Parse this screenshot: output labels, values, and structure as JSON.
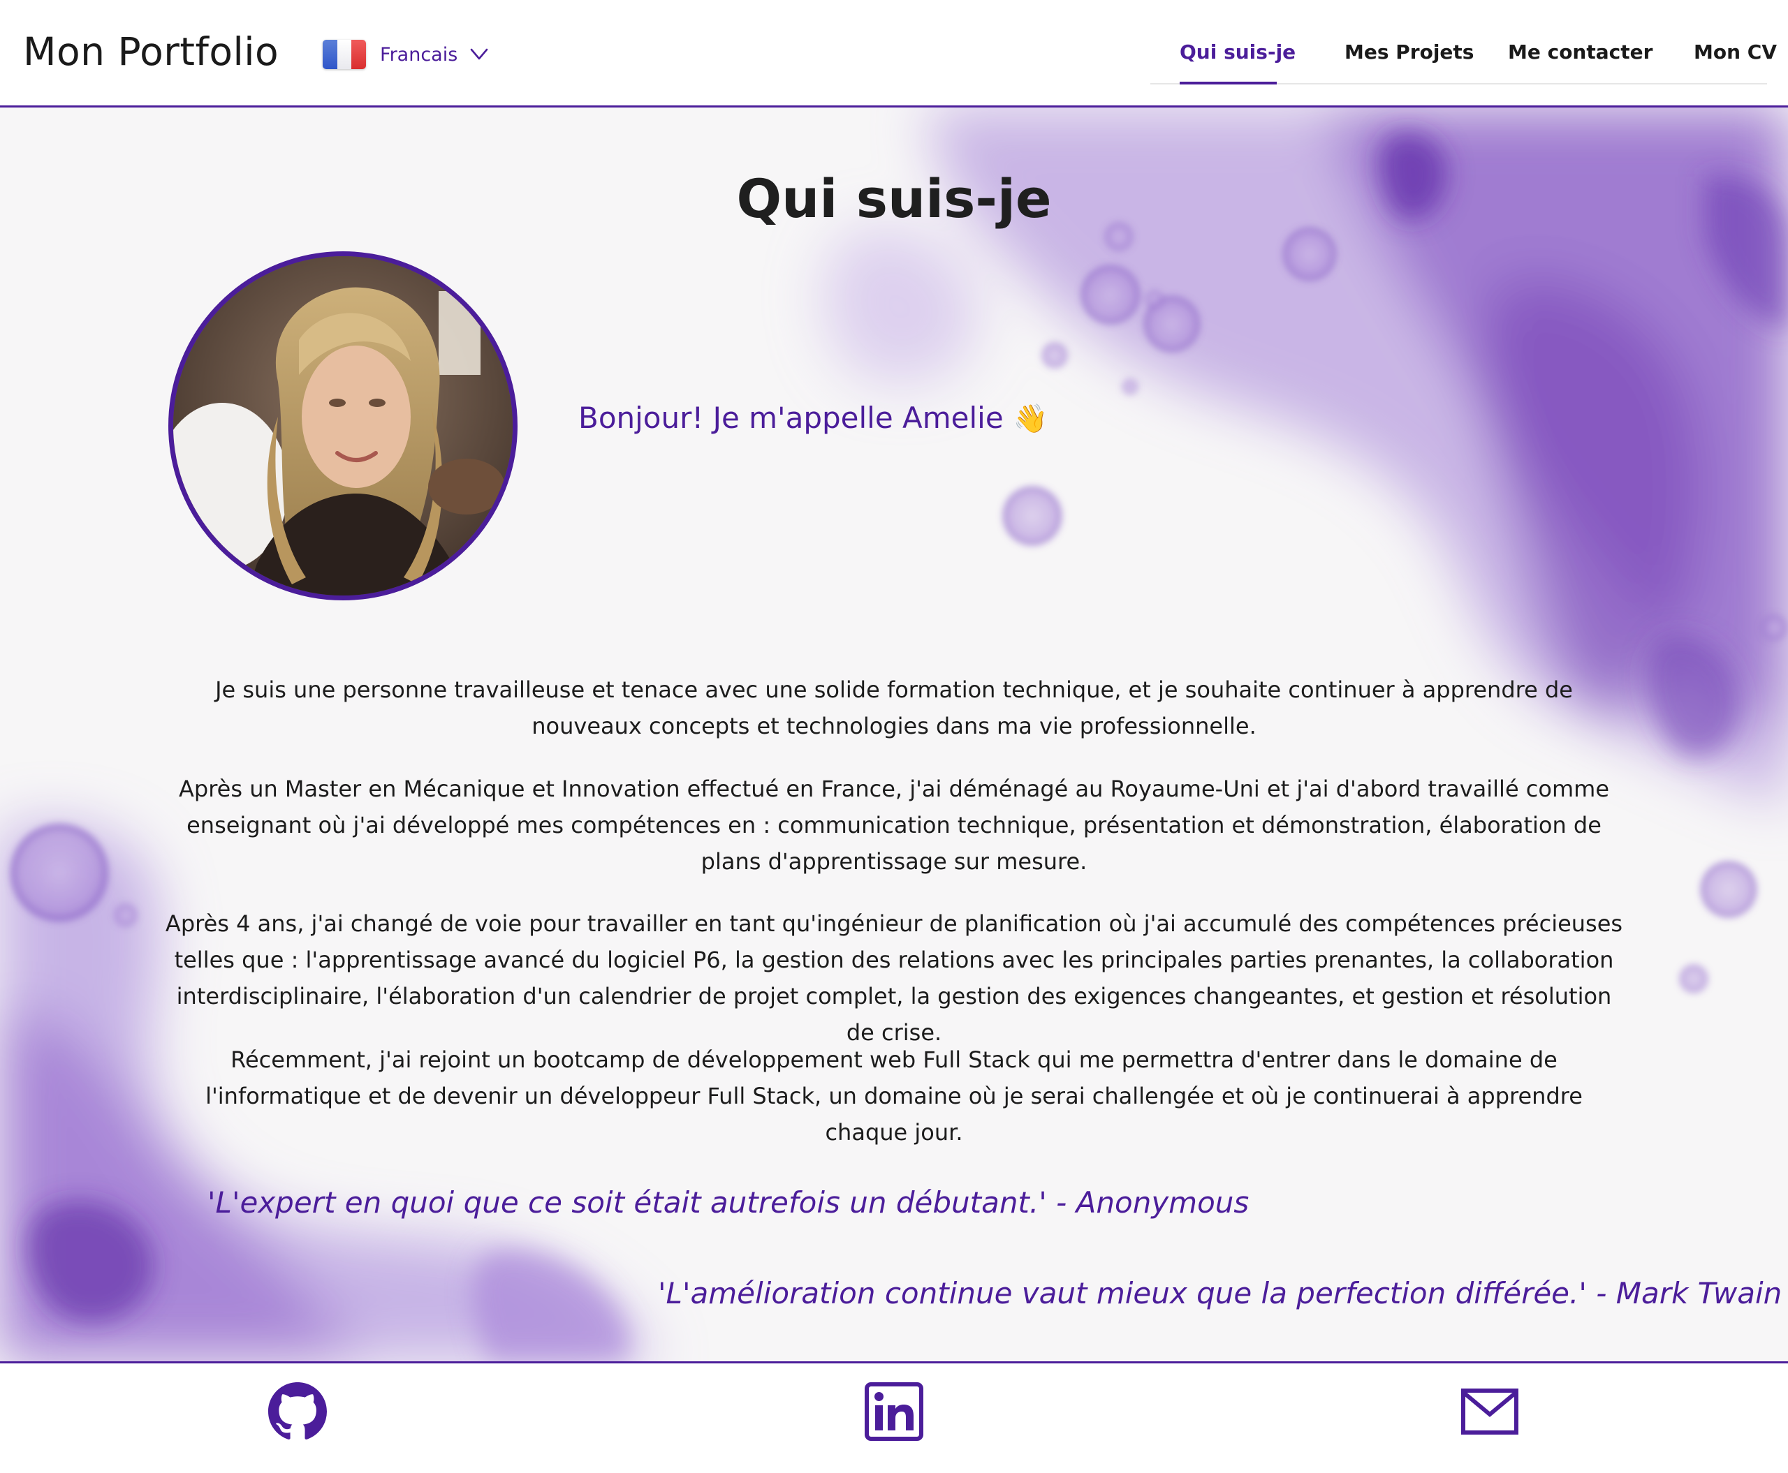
{
  "header": {
    "brand": "Mon Portfolio",
    "language": {
      "selected": "Francais",
      "flag_icon": "france-flag-icon"
    },
    "nav": [
      {
        "label": "Qui suis-je",
        "active": true
      },
      {
        "label": "Mes Projets",
        "active": false
      },
      {
        "label": "Me contacter",
        "active": false
      },
      {
        "label": "Mon CV",
        "active": false
      }
    ]
  },
  "about": {
    "title": "Qui suis-je",
    "greeting": "Bonjour! Je m'appelle Amelie",
    "greeting_emoji": "👋",
    "paragraphs": [
      "Je suis une personne travailleuse et tenace avec une solide formation technique, et je souhaite continuer à apprendre de nouveaux concepts et technologies dans ma vie professionnelle.",
      "Après un Master en Mécanique et Innovation effectué en France, j'ai déménagé au Royaume-Uni et j'ai d'abord travaillé comme enseignant où j'ai développé mes compétences en : communication technique, présentation et démonstration, élaboration de plans d'apprentissage sur mesure.",
      "Après 4 ans, j'ai changé de voie pour travailler en tant qu'ingénieur de planification où j'ai accumulé des compétences précieuses telles que : l'apprentissage avancé du logiciel P6, la gestion des relations avec les principales parties prenantes, la collaboration interdisciplinaire, l'élaboration d'un calendrier de projet complet, la gestion des exigences changeantes, et gestion et résolution de crise.",
      "Récemment, j'ai rejoint un bootcamp de développement web Full Stack qui me permettra d'entrer dans le domaine de l'informatique et de devenir un développeur Full Stack, un domaine où je serai challengée et où je continuerai à apprendre chaque jour."
    ],
    "quotes": [
      "'L'expert en quoi que ce soit était autrefois un débutant.' - Anonymous",
      "'L'amélioration continue vaut mieux que la perfection différée.' - Mark Twain"
    ]
  },
  "footer": {
    "icons": [
      "github-icon",
      "linkedin-icon",
      "mail-icon"
    ]
  },
  "colors": {
    "accent": "#4b1d9a",
    "watercolor": "#8e63c7",
    "text": "#1c1c1c"
  }
}
